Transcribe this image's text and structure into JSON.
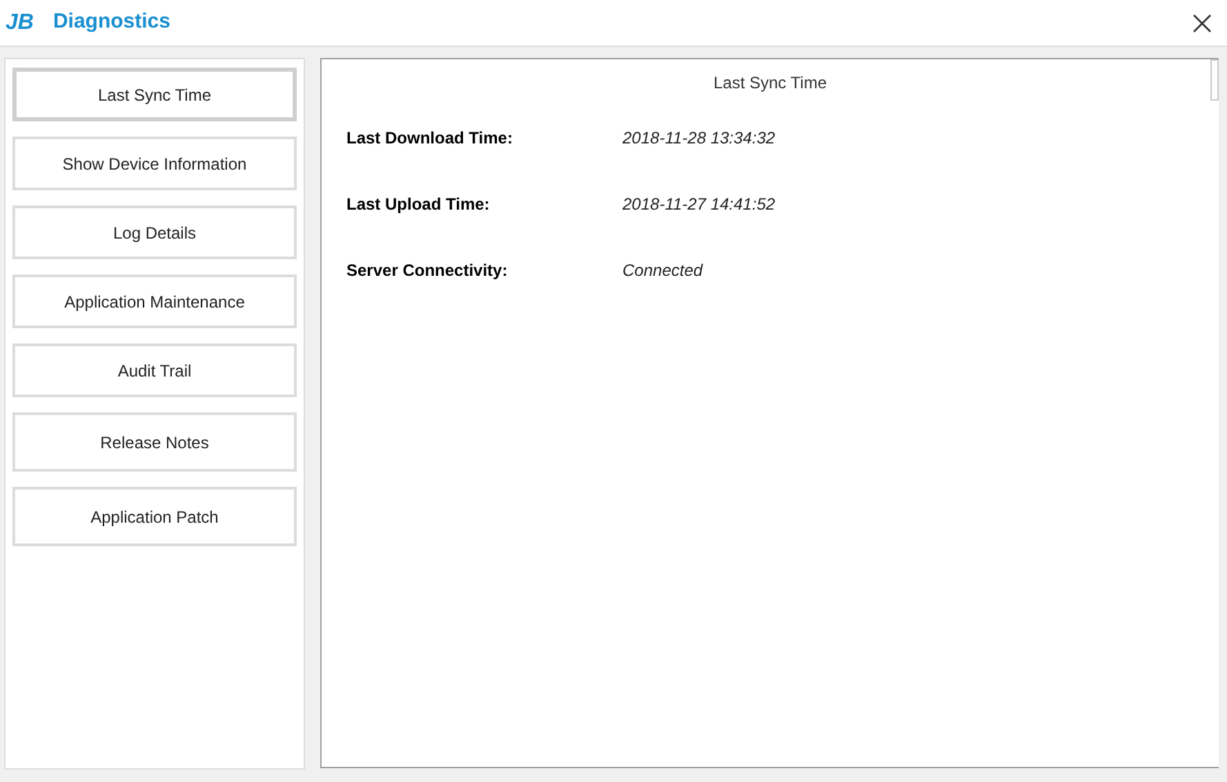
{
  "window": {
    "logo": "JB",
    "title": "Diagnostics"
  },
  "sidebar": {
    "items": [
      {
        "label": "Last Sync Time",
        "selected": true
      },
      {
        "label": "Show Device Information",
        "selected": false
      },
      {
        "label": "Log Details",
        "selected": false
      },
      {
        "label": "Application Maintenance",
        "selected": false
      },
      {
        "label": "Audit Trail",
        "selected": false
      },
      {
        "label": "Release Notes",
        "selected": false
      },
      {
        "label": "Application Patch",
        "selected": false
      }
    ]
  },
  "panel": {
    "heading": "Last Sync Time",
    "fields": [
      {
        "label": "Last Download Time:",
        "value": "2018-11-28 13:34:32"
      },
      {
        "label": "Last Upload Time:",
        "value": "2018-11-27 14:41:52"
      },
      {
        "label": "Server Connectivity:",
        "value": "Connected"
      }
    ]
  }
}
